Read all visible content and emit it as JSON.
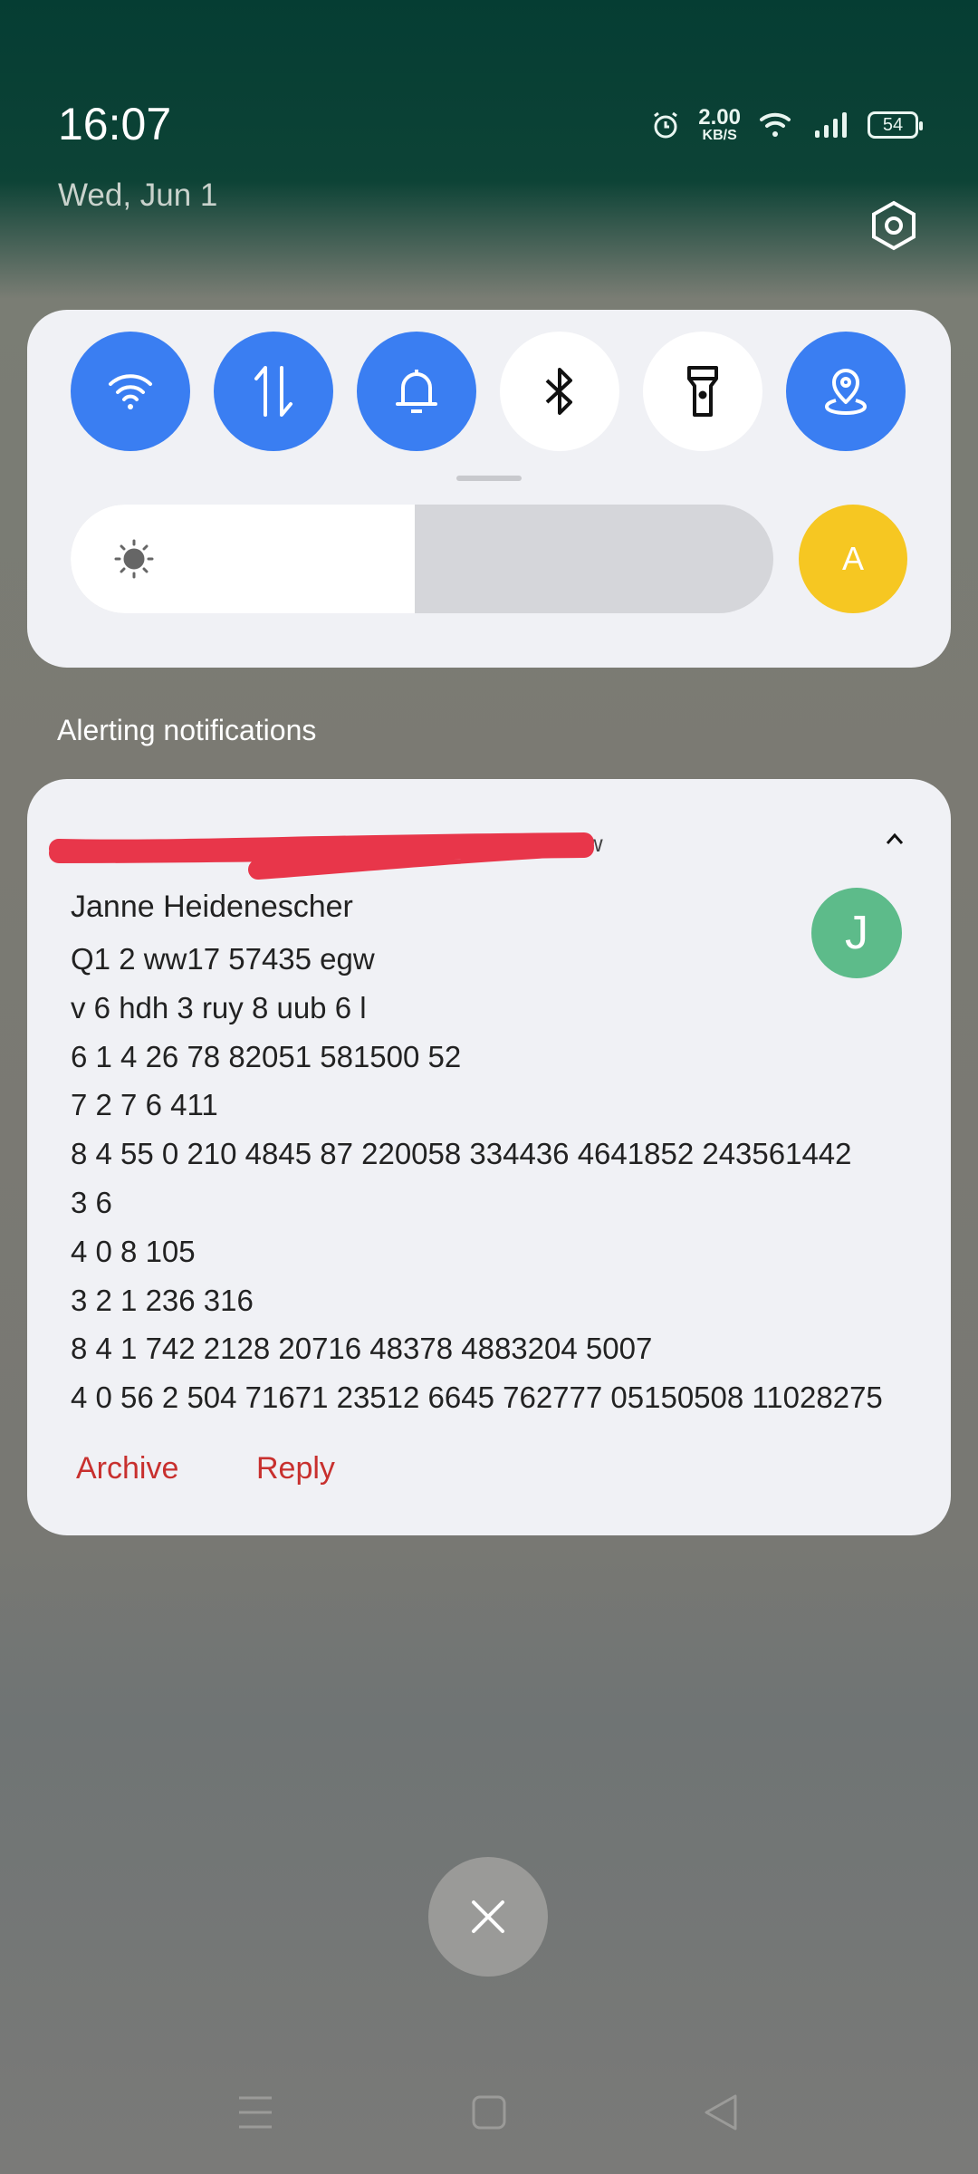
{
  "status_bar": {
    "time": "16:07",
    "date": "Wed, Jun 1",
    "net_speed_value": "2.00",
    "net_speed_unit": "KB/S",
    "battery": "54",
    "icons": [
      "alarm-icon",
      "wifi-icon",
      "signal-icon",
      "battery-icon"
    ]
  },
  "quick_settings": {
    "toggles": [
      {
        "name": "wifi",
        "icon": "wifi-icon",
        "on": true
      },
      {
        "name": "mobile-data",
        "icon": "data-arrows-icon",
        "on": true
      },
      {
        "name": "sound",
        "icon": "bell-icon",
        "on": true
      },
      {
        "name": "bluetooth",
        "icon": "bluetooth-icon",
        "on": false
      },
      {
        "name": "flashlight",
        "icon": "flashlight-icon",
        "on": false
      },
      {
        "name": "location",
        "icon": "location-icon",
        "on": true
      }
    ],
    "brightness_percent": 49,
    "auto_brightness_label": "A",
    "accent": "#3a7ef2",
    "auto_color": "#f6c722"
  },
  "section_title": "Alerting notifications",
  "notification": {
    "time": "now",
    "sender": "Janne Heidenescher",
    "avatar_letter": "J",
    "avatar_color": "#5dbb8a",
    "lines": [
      "Q1 2 ww17 57435 egw",
      "v 6 hdh 3 ruy 8 uub 6 l",
      "6 1 4 26 78 82051 581500 52",
      "7 2 7 6 411",
      "8 4 55 0 210 4845 87 220058 334436 4641852 243561442",
      "3 6",
      "4 0 8 105",
      "3 2 1 236 316",
      "8 4 1 742 2128 20716 48378 4883204 5007",
      "4 0 56 2 504 71671 23512 6645 762777 05150508 11028275"
    ],
    "actions": [
      "Archive",
      "Reply"
    ],
    "action_color": "#c8302e"
  }
}
